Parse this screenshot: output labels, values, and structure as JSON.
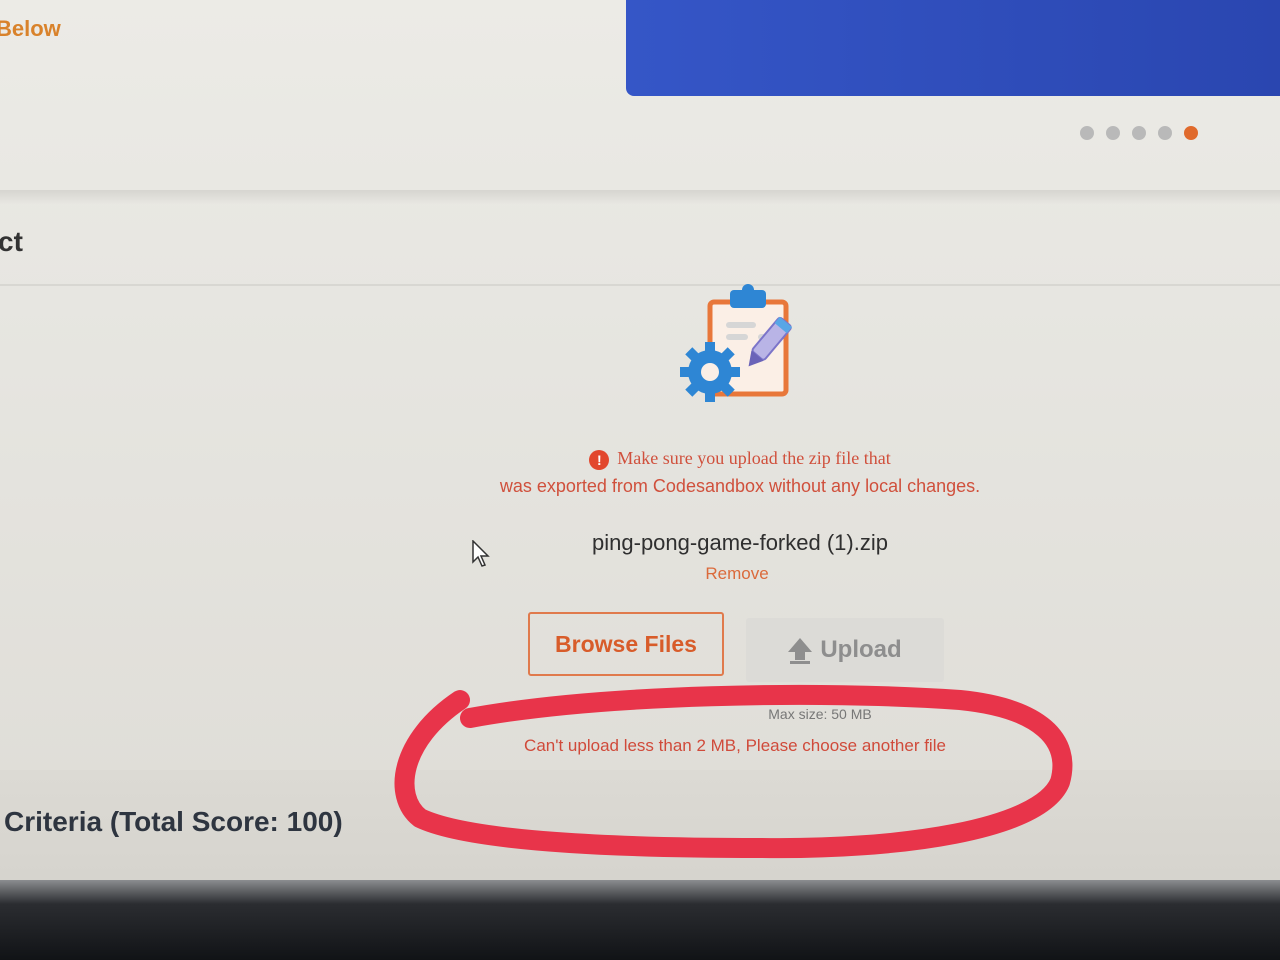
{
  "header": {
    "top_label": "Below",
    "section_label": "ct",
    "pager": {
      "count": 5,
      "active": 5
    }
  },
  "colors": {
    "accent": "#e06a2c",
    "banner": "#3556c7",
    "error": "#d04a3a",
    "annotation": "#e8344a"
  },
  "upload": {
    "notice_icon": "info-icon",
    "notice_line1": "Make sure you upload the zip file that",
    "notice_line2": "was exported from Codesandbox without any local changes.",
    "filename": "ping-pong-game-forked (1).zip",
    "remove_label": "Remove",
    "browse_label": "Browse Files",
    "upload_label": "Upload",
    "upload_icon": "upload-arrow-icon",
    "max_size": "Max size: 50 MB",
    "error_message": "Can't upload less than 2 MB, Please choose another file"
  },
  "criteria": {
    "title": "Criteria (Total Score: 100)"
  }
}
